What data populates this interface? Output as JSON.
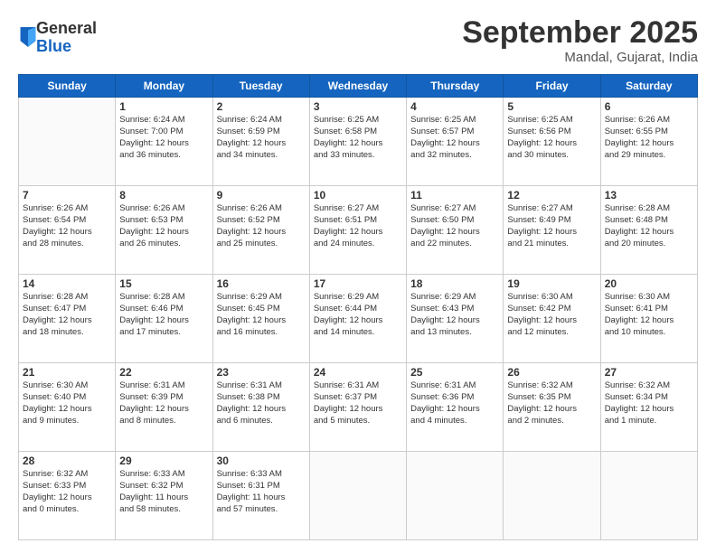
{
  "header": {
    "logo_general": "General",
    "logo_blue": "Blue",
    "month_title": "September 2025",
    "location": "Mandal, Gujarat, India"
  },
  "days_of_week": [
    "Sunday",
    "Monday",
    "Tuesday",
    "Wednesday",
    "Thursday",
    "Friday",
    "Saturday"
  ],
  "weeks": [
    [
      {
        "day": "",
        "info": ""
      },
      {
        "day": "1",
        "info": "Sunrise: 6:24 AM\nSunset: 7:00 PM\nDaylight: 12 hours\nand 36 minutes."
      },
      {
        "day": "2",
        "info": "Sunrise: 6:24 AM\nSunset: 6:59 PM\nDaylight: 12 hours\nand 34 minutes."
      },
      {
        "day": "3",
        "info": "Sunrise: 6:25 AM\nSunset: 6:58 PM\nDaylight: 12 hours\nand 33 minutes."
      },
      {
        "day": "4",
        "info": "Sunrise: 6:25 AM\nSunset: 6:57 PM\nDaylight: 12 hours\nand 32 minutes."
      },
      {
        "day": "5",
        "info": "Sunrise: 6:25 AM\nSunset: 6:56 PM\nDaylight: 12 hours\nand 30 minutes."
      },
      {
        "day": "6",
        "info": "Sunrise: 6:26 AM\nSunset: 6:55 PM\nDaylight: 12 hours\nand 29 minutes."
      }
    ],
    [
      {
        "day": "7",
        "info": "Sunrise: 6:26 AM\nSunset: 6:54 PM\nDaylight: 12 hours\nand 28 minutes."
      },
      {
        "day": "8",
        "info": "Sunrise: 6:26 AM\nSunset: 6:53 PM\nDaylight: 12 hours\nand 26 minutes."
      },
      {
        "day": "9",
        "info": "Sunrise: 6:26 AM\nSunset: 6:52 PM\nDaylight: 12 hours\nand 25 minutes."
      },
      {
        "day": "10",
        "info": "Sunrise: 6:27 AM\nSunset: 6:51 PM\nDaylight: 12 hours\nand 24 minutes."
      },
      {
        "day": "11",
        "info": "Sunrise: 6:27 AM\nSunset: 6:50 PM\nDaylight: 12 hours\nand 22 minutes."
      },
      {
        "day": "12",
        "info": "Sunrise: 6:27 AM\nSunset: 6:49 PM\nDaylight: 12 hours\nand 21 minutes."
      },
      {
        "day": "13",
        "info": "Sunrise: 6:28 AM\nSunset: 6:48 PM\nDaylight: 12 hours\nand 20 minutes."
      }
    ],
    [
      {
        "day": "14",
        "info": "Sunrise: 6:28 AM\nSunset: 6:47 PM\nDaylight: 12 hours\nand 18 minutes."
      },
      {
        "day": "15",
        "info": "Sunrise: 6:28 AM\nSunset: 6:46 PM\nDaylight: 12 hours\nand 17 minutes."
      },
      {
        "day": "16",
        "info": "Sunrise: 6:29 AM\nSunset: 6:45 PM\nDaylight: 12 hours\nand 16 minutes."
      },
      {
        "day": "17",
        "info": "Sunrise: 6:29 AM\nSunset: 6:44 PM\nDaylight: 12 hours\nand 14 minutes."
      },
      {
        "day": "18",
        "info": "Sunrise: 6:29 AM\nSunset: 6:43 PM\nDaylight: 12 hours\nand 13 minutes."
      },
      {
        "day": "19",
        "info": "Sunrise: 6:30 AM\nSunset: 6:42 PM\nDaylight: 12 hours\nand 12 minutes."
      },
      {
        "day": "20",
        "info": "Sunrise: 6:30 AM\nSunset: 6:41 PM\nDaylight: 12 hours\nand 10 minutes."
      }
    ],
    [
      {
        "day": "21",
        "info": "Sunrise: 6:30 AM\nSunset: 6:40 PM\nDaylight: 12 hours\nand 9 minutes."
      },
      {
        "day": "22",
        "info": "Sunrise: 6:31 AM\nSunset: 6:39 PM\nDaylight: 12 hours\nand 8 minutes."
      },
      {
        "day": "23",
        "info": "Sunrise: 6:31 AM\nSunset: 6:38 PM\nDaylight: 12 hours\nand 6 minutes."
      },
      {
        "day": "24",
        "info": "Sunrise: 6:31 AM\nSunset: 6:37 PM\nDaylight: 12 hours\nand 5 minutes."
      },
      {
        "day": "25",
        "info": "Sunrise: 6:31 AM\nSunset: 6:36 PM\nDaylight: 12 hours\nand 4 minutes."
      },
      {
        "day": "26",
        "info": "Sunrise: 6:32 AM\nSunset: 6:35 PM\nDaylight: 12 hours\nand 2 minutes."
      },
      {
        "day": "27",
        "info": "Sunrise: 6:32 AM\nSunset: 6:34 PM\nDaylight: 12 hours\nand 1 minute."
      }
    ],
    [
      {
        "day": "28",
        "info": "Sunrise: 6:32 AM\nSunset: 6:33 PM\nDaylight: 12 hours\nand 0 minutes."
      },
      {
        "day": "29",
        "info": "Sunrise: 6:33 AM\nSunset: 6:32 PM\nDaylight: 11 hours\nand 58 minutes."
      },
      {
        "day": "30",
        "info": "Sunrise: 6:33 AM\nSunset: 6:31 PM\nDaylight: 11 hours\nand 57 minutes."
      },
      {
        "day": "",
        "info": ""
      },
      {
        "day": "",
        "info": ""
      },
      {
        "day": "",
        "info": ""
      },
      {
        "day": "",
        "info": ""
      }
    ]
  ]
}
